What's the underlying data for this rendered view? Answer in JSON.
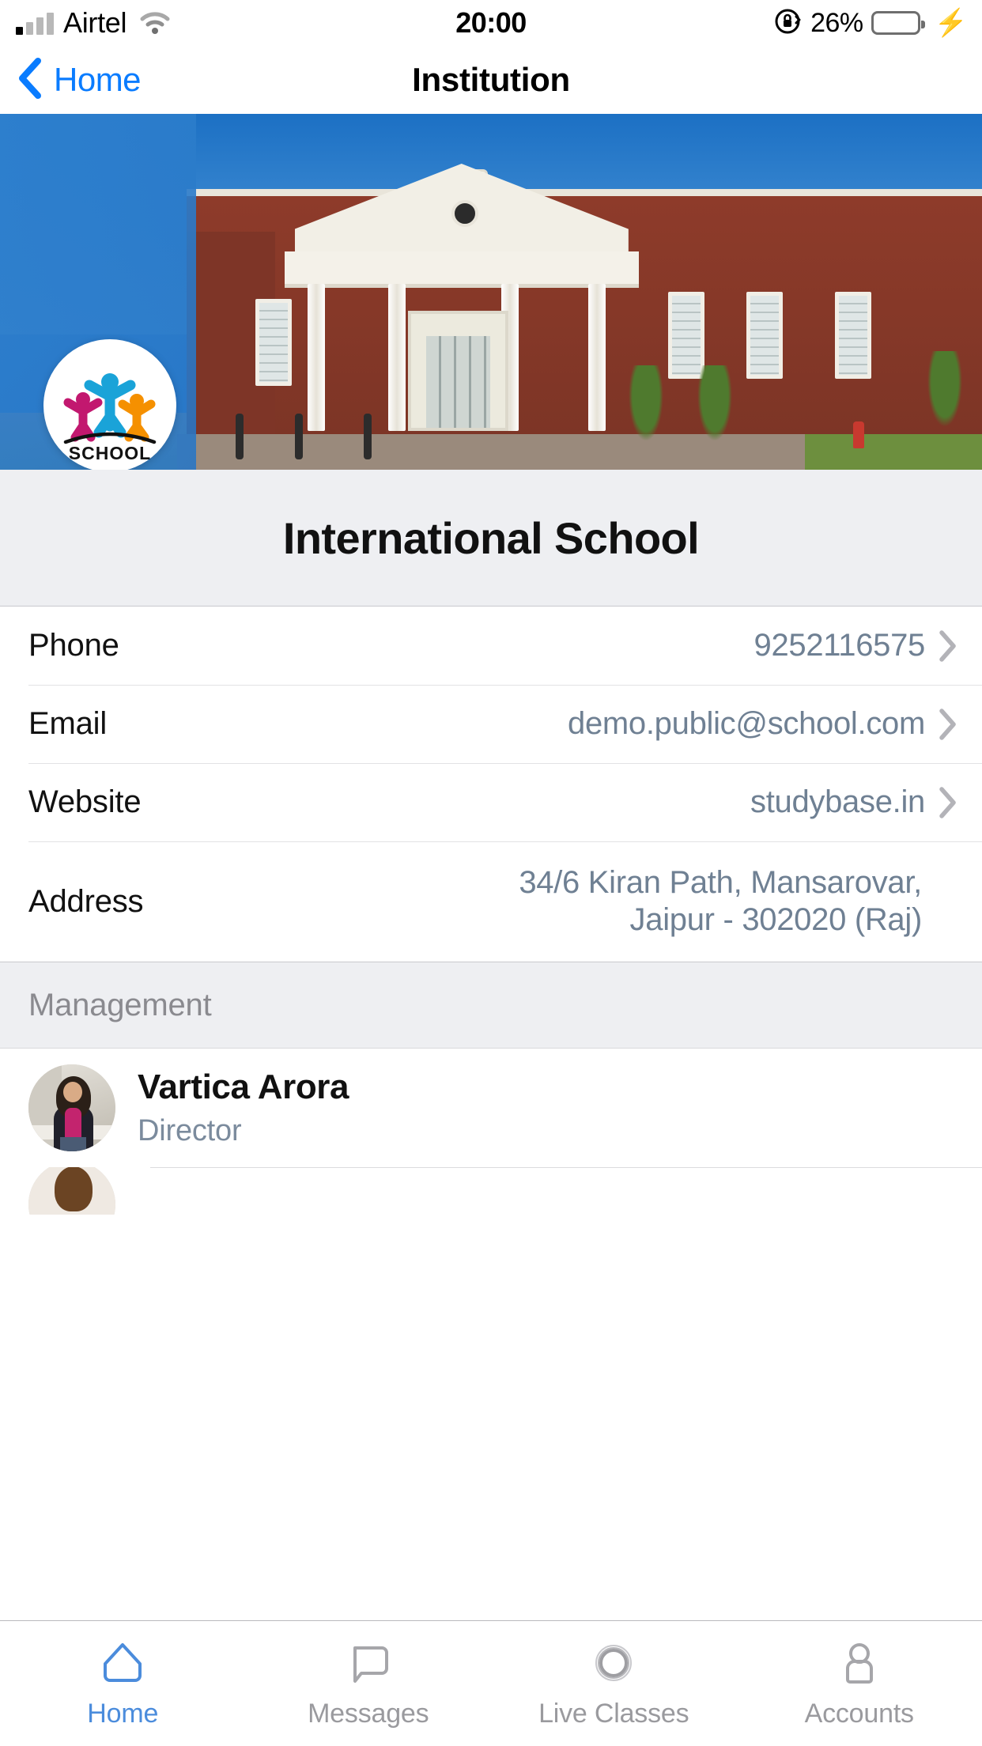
{
  "status_bar": {
    "carrier": "Airtel",
    "time": "20:00",
    "battery_percent": "26%",
    "battery_level": 26,
    "wifi_icon": "wifi-icon",
    "rotation_lock_icon": "rotation-lock-icon",
    "charging_icon": "charging-bolt-icon"
  },
  "nav": {
    "back_label": "Home",
    "back_icon": "chevron-left-icon",
    "title": "Institution"
  },
  "banner": {
    "logo_text": "SCHOOL",
    "logo_alt": "school-logo",
    "photo_alt": "school-building-photo"
  },
  "school": {
    "name": "International School"
  },
  "info_rows": [
    {
      "label": "Phone",
      "value": "9252116575",
      "chevron": true
    },
    {
      "label": "Email",
      "value": "demo.public@school.com",
      "chevron": true
    },
    {
      "label": "Website",
      "value": "studybase.in",
      "chevron": true
    },
    {
      "label": "Address",
      "value_line1": "34/6 Kiran Path, Mansarovar,",
      "value_line2": "Jaipur - 302020 (Raj)",
      "chevron": false
    }
  ],
  "management": {
    "section_title": "Management",
    "people": [
      {
        "name": "Vartica Arora",
        "role": "Director",
        "avatar": "person-avatar"
      }
    ]
  },
  "tabs": [
    {
      "label": "Home",
      "icon": "home-icon",
      "active": true
    },
    {
      "label": "Messages",
      "icon": "message-bubble-icon",
      "active": false
    },
    {
      "label": "Live Classes",
      "icon": "live-circle-icon",
      "active": false
    },
    {
      "label": "Accounts",
      "icon": "person-icon",
      "active": false
    }
  ],
  "colors": {
    "accent_blue": "#0a7cff",
    "tab_active": "#4b8cdc",
    "value_text": "#6f8093",
    "section_bg": "#eeeff2",
    "battery_green": "#32d24d"
  }
}
